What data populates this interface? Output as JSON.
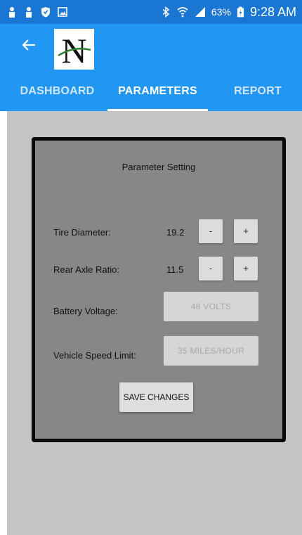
{
  "status_bar": {
    "battery_percent": "63%",
    "time": "9:28 AM",
    "icons": [
      "notification-icon",
      "notification-icon",
      "shield-icon",
      "image-icon",
      "bluetooth-icon",
      "wifi-icon",
      "signal-icon",
      "battery-charging-icon"
    ]
  },
  "app_bar": {
    "logo_letter": "N",
    "tabs": [
      {
        "label": "DASHBOARD",
        "active": false
      },
      {
        "label": "PARAMETERS",
        "active": true
      },
      {
        "label": "REPORT",
        "active": false
      }
    ]
  },
  "card": {
    "title": "Parameter Setting",
    "tire_diameter": {
      "label": "Tire Diameter:",
      "value": "19.2",
      "decrement": "-",
      "increment": "+"
    },
    "rear_axle_ratio": {
      "label": "Rear Axle Ratio:",
      "value": "11.5",
      "decrement": "-",
      "increment": "+"
    },
    "battery_voltage": {
      "label": "Battery Voltage:",
      "value": "48 VOLTS"
    },
    "vehicle_speed_limit": {
      "label": "Vehicle Speed Limit:",
      "value": "35 MILES/HOUR"
    },
    "save_label": "SAVE CHANGES"
  },
  "colors": {
    "status_bar": "#1976d2",
    "app_bar": "#2196f3",
    "content_background": "#c4c4c4",
    "card_background": "#878787",
    "card_border": "#0a0a0a"
  }
}
